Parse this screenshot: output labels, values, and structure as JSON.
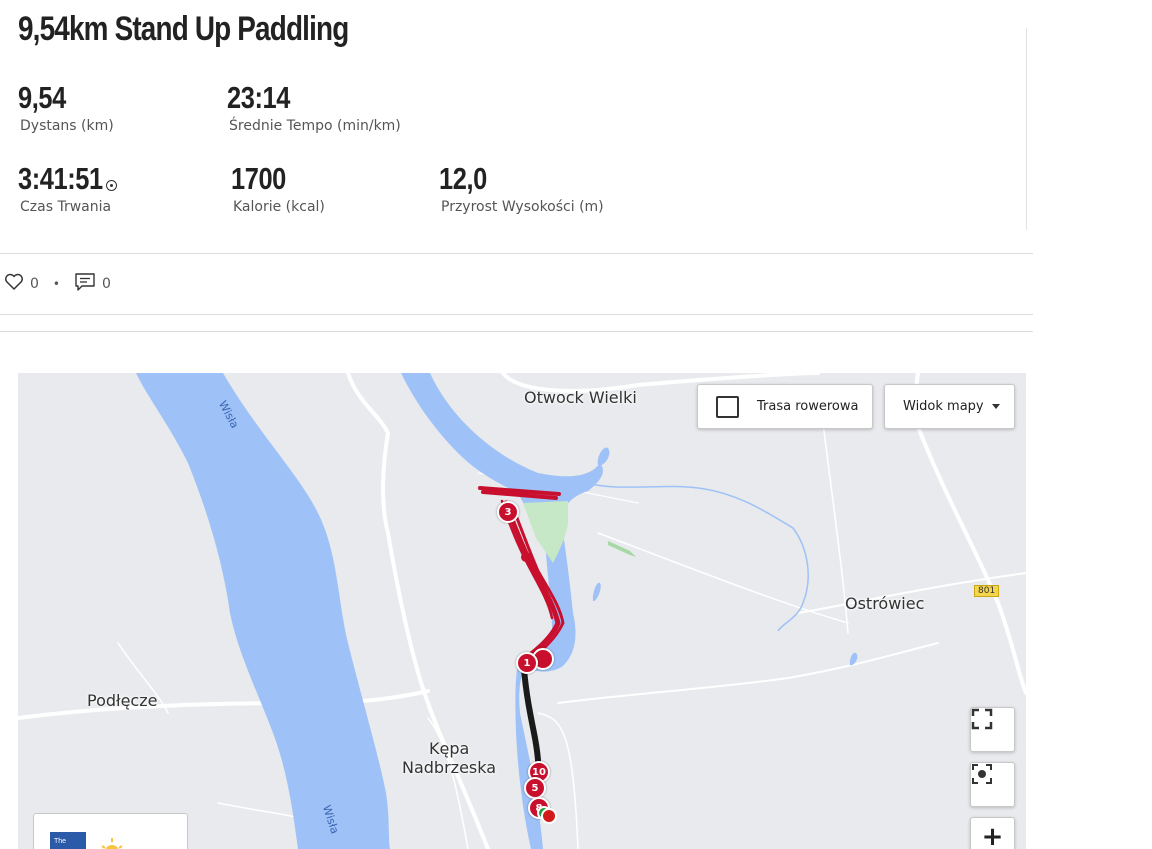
{
  "activity": {
    "title": "9,54km Stand Up Paddling"
  },
  "stats": [
    {
      "value": "9,54",
      "label": "Dystans (km)"
    },
    {
      "value": "23:14",
      "label": "Średnie Tempo (min/km)"
    },
    {
      "value": "3:41:51",
      "label": "Czas Trwania"
    },
    {
      "value": "1700",
      "label": "Kalorie (kcal)"
    },
    {
      "value": "12,0",
      "label": "Przyrost Wysokości (m)"
    }
  ],
  "social": {
    "likes": "0",
    "comments": "0",
    "separator": "•"
  },
  "map": {
    "places": {
      "otwock": "Otwock Wielki",
      "ostrowiec": "Ostrówiec",
      "podlecze": "Podłęcze",
      "kepa_line1": "Kępa",
      "kepa_line2": "Nadbrzeska"
    },
    "river_labels": [
      "Wisła",
      "Wisła"
    ],
    "road_number": "801",
    "bike_route_label": "Trasa rowerowa",
    "map_view_label": "Widok mapy",
    "zoom_in_label": "+",
    "legend_logo_text": "The",
    "lap_markers": [
      "3",
      "1",
      "10",
      "5",
      "8"
    ],
    "colors": {
      "water": "#9ec2f7",
      "route": "#c8102e",
      "route_dark": "#1a1a1a",
      "park": "#c6e8c6",
      "land": "#e8eaed"
    }
  }
}
